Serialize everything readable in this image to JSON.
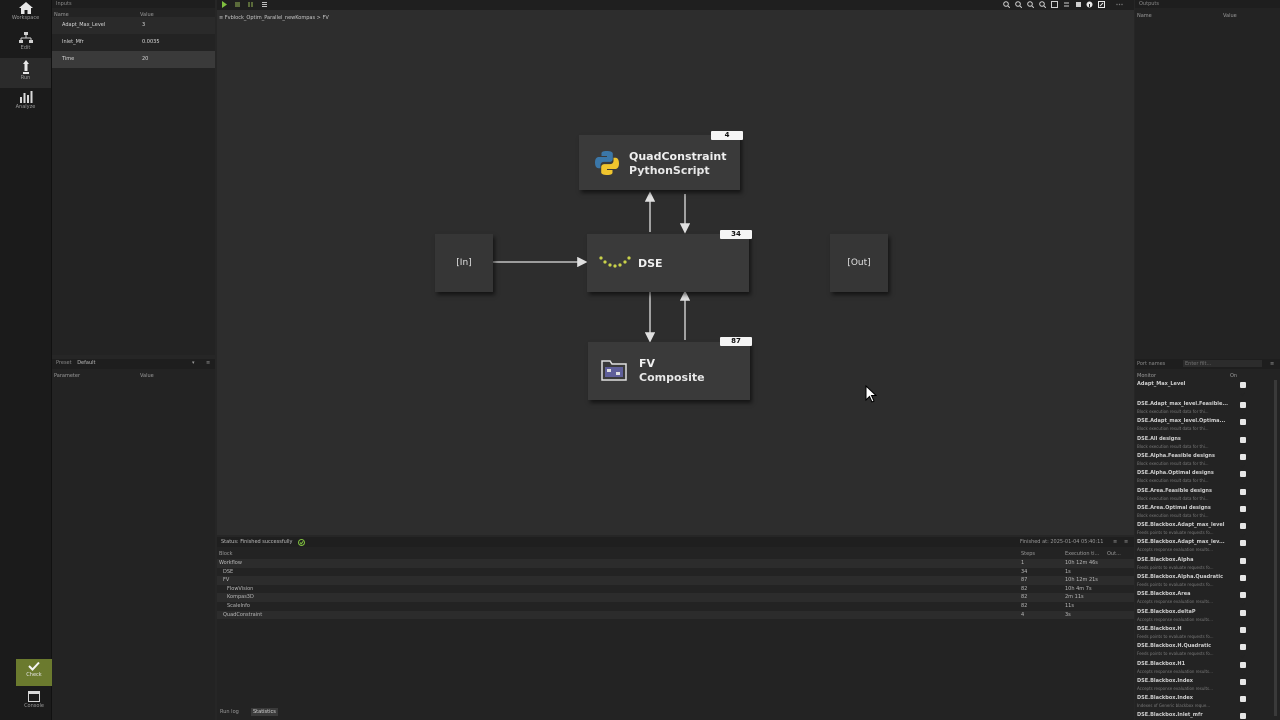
{
  "nav": {
    "items": [
      {
        "label": "Workspace",
        "icon": "home-icon"
      },
      {
        "label": "Edit",
        "icon": "edit-icon"
      },
      {
        "label": "Run",
        "icon": "run-icon"
      },
      {
        "label": "Analyze",
        "icon": "analyze-icon"
      }
    ],
    "check_label": "Check",
    "console_label": "Console"
  },
  "inputs": {
    "title": "Inputs",
    "col_name": "Name",
    "col_value": "Value",
    "rows": [
      {
        "name": "Adapt_Max_Level",
        "value": "3"
      },
      {
        "name": "Inlet_Mfr",
        "value": "0.0035"
      },
      {
        "name": "Time",
        "value": "20"
      }
    ]
  },
  "preset": {
    "label": "Preset",
    "value": "Default",
    "col_param": "Parameter",
    "col_value": "Value"
  },
  "breadcrumb": {
    "root": "Fvblock_Optim_Parallel_newKompas",
    "sep": ">",
    "leaf": "FV"
  },
  "graph": {
    "quad": {
      "name": "QuadConstraint",
      "type": "PythonScript",
      "badge": "4"
    },
    "dse": {
      "name": "DSE",
      "badge": "34"
    },
    "fv": {
      "name": "FV",
      "type": "Composite",
      "badge": "87"
    },
    "in_label": "[In]",
    "out_label": "[Out]"
  },
  "status": {
    "text": "Status: Finished successfully",
    "finished": "Finished at: 2025-01-04 05:40:11"
  },
  "blocks": {
    "col_block": "Block",
    "col_steps": "Steps",
    "col_exec": "Execution ti...",
    "col_out": "Out...",
    "rows": [
      {
        "block": "Workflow",
        "steps": "1",
        "exec": "10h 12m 46s"
      },
      {
        "block": "DSE",
        "steps": "34",
        "exec": "1s"
      },
      {
        "block": "FV",
        "steps": "87",
        "exec": "10h 12m 21s"
      },
      {
        "block": "FlowVision",
        "steps": "82",
        "exec": "10h 4m 7s"
      },
      {
        "block": "Kompas3D",
        "steps": "82",
        "exec": "2m 11s"
      },
      {
        "block": "ScaleInfo",
        "steps": "82",
        "exec": "11s"
      },
      {
        "block": "QuadConstraint",
        "steps": "4",
        "exec": "3s"
      }
    ],
    "tabs": [
      "Run log",
      "Statistics"
    ]
  },
  "outputs": {
    "title": "Outputs",
    "col_name": "Name",
    "col_value": "Value"
  },
  "monitor": {
    "filter_label": "Port names",
    "filter_placeholder": "Enter filt...",
    "col_monitor": "Monitor",
    "col_on": "On",
    "items": [
      {
        "name": "Adapt_Max_Level",
        "desc": ""
      },
      {
        "name": "DSE.Adapt_max_level.Feasible...",
        "desc": "Block execution result data for thi..."
      },
      {
        "name": "DSE.Adapt_max_level.Optima...",
        "desc": "Block execution result data for thi..."
      },
      {
        "name": "DSE.All designs",
        "desc": "Block execution result data for thi..."
      },
      {
        "name": "DSE.Alpha.Feasible designs",
        "desc": "Block execution result data for thi..."
      },
      {
        "name": "DSE.Alpha.Optimal designs",
        "desc": "Block execution result data for thi..."
      },
      {
        "name": "DSE.Area.Feasible designs",
        "desc": "Block execution result data for thi..."
      },
      {
        "name": "DSE.Area.Optimal designs",
        "desc": "Block execution result data for thi..."
      },
      {
        "name": "DSE.Blackbox.Adapt_max_level",
        "desc": "Feeds points to evaluate requests fo..."
      },
      {
        "name": "DSE.Blackbox.Adapt_max_lev...",
        "desc": "Accepts response evaluation results..."
      },
      {
        "name": "DSE.Blackbox.Alpha",
        "desc": "Feeds points to evaluate requests fo..."
      },
      {
        "name": "DSE.Blackbox.Alpha.Quadratic",
        "desc": "Feeds points to evaluate requests fo..."
      },
      {
        "name": "DSE.Blackbox.Area",
        "desc": "Accepts response evaluation results..."
      },
      {
        "name": "DSE.Blackbox.deltaP",
        "desc": "Accepts response evaluation results..."
      },
      {
        "name": "DSE.Blackbox.H",
        "desc": "Feeds points to evaluate requests fo..."
      },
      {
        "name": "DSE.Blackbox.H.Quadratic",
        "desc": "Feeds points to evaluate requests fo..."
      },
      {
        "name": "DSE.Blackbox.H1",
        "desc": "Accepts response evaluation results..."
      },
      {
        "name": "DSE.Blackbox.Index",
        "desc": "Accepts response evaluation results..."
      },
      {
        "name": "DSE.Blackbox.Index",
        "desc": "Indexes of Generic blackbox reque..."
      },
      {
        "name": "DSE.Blackbox.Inlet_mfr",
        "desc": ""
      }
    ]
  }
}
